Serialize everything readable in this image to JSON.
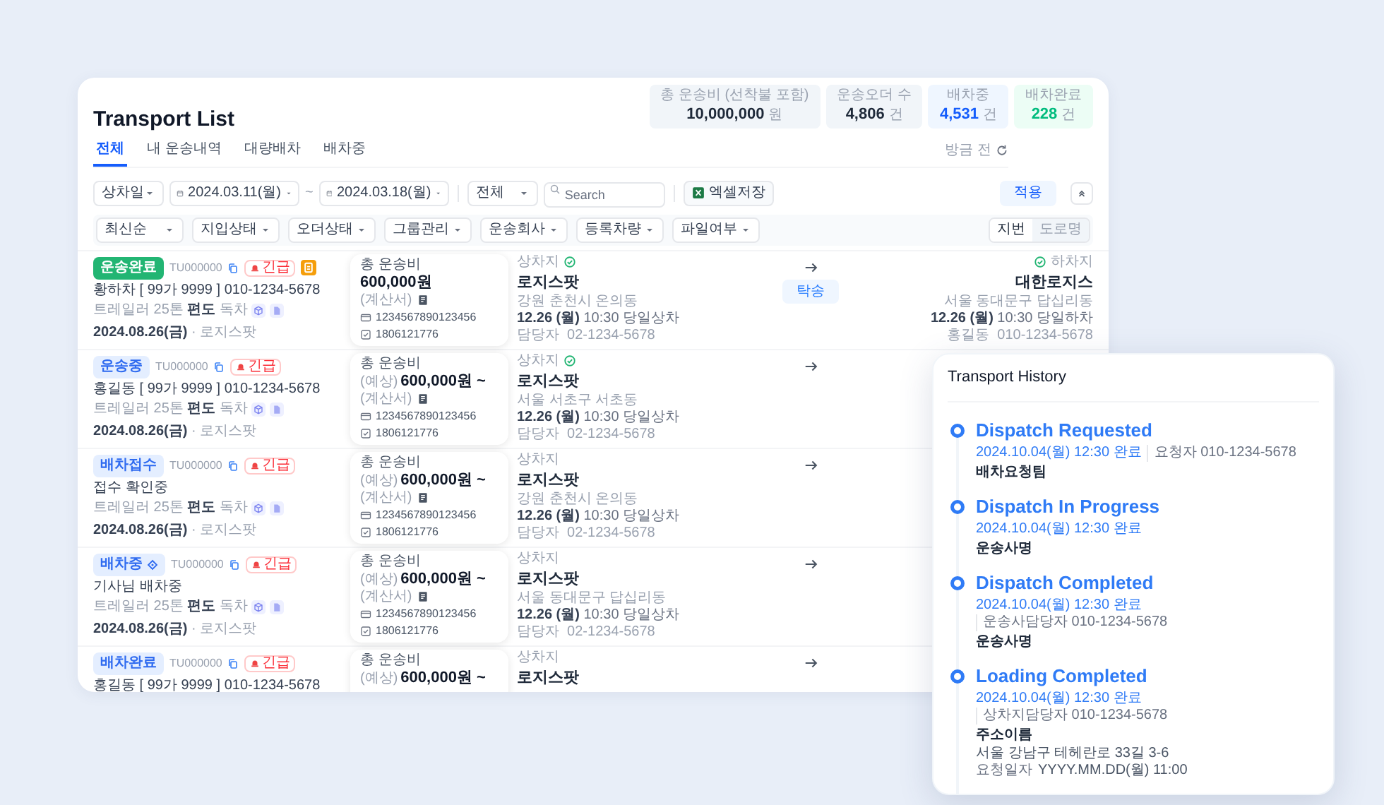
{
  "header": {
    "title": "Transport List",
    "refresh": "방금 전",
    "tabs": [
      {
        "label": "전체",
        "selected": true
      },
      {
        "label": "내 운송내역",
        "selected": false
      },
      {
        "label": "대량배차",
        "selected": false
      },
      {
        "label": "배차중",
        "selected": false
      }
    ]
  },
  "stats": [
    {
      "label": "총 운송비 (선착불 포함)",
      "value": "10,000,000",
      "unit": "원",
      "kind": "total"
    },
    {
      "label": "운송오더 수",
      "value": "4,806",
      "unit": "건",
      "kind": "count"
    },
    {
      "label": "배차중",
      "value": "4,531",
      "unit": "건",
      "kind": "dispatching"
    },
    {
      "label": "배차완료",
      "value": "228",
      "unit": "건",
      "kind": "done"
    }
  ],
  "filters": {
    "date_type": "상차일",
    "start_date": "2024.03.11(월)",
    "separator": "~",
    "end_date": "2024.03.18(월)",
    "scope": "전체",
    "search_placeholder": "Search",
    "excel": "엑셀저장",
    "apply": "적용",
    "dropdowns": [
      "최신순",
      "지입상태",
      "오더상태",
      "그룹관리",
      "운송회사",
      "등록차량",
      "파일여부"
    ],
    "address_modes": [
      {
        "label": "지번",
        "selected": true
      },
      {
        "label": "도로명",
        "selected": false
      }
    ]
  },
  "orders": [
    {
      "status": "운송완료",
      "color": "#22b573",
      "status_icon": false,
      "code": "TU000000",
      "urgent": "긴급",
      "document": true,
      "name": "황하차 [ 99가 9999 ] 010-1234-5678",
      "vehicle": "트레일러 25톤 **편도** 독차",
      "date": "**2024.08.26(금)** · 로지스팟",
      "fee": {
        "label": "총 운송비",
        "amount": "600,000원",
        "invoice": "(계산서)",
        "card": "1234567890123456",
        "phone": "1806121776"
      },
      "pickup": {
        "label": "상차지",
        "confirmed": true,
        "place": "로지스팟",
        "address": "강원 춘천시 온의동",
        "time": "**12.26 (월)** 10:30 당일상차",
        "contact": "담당자  02-1234-5678"
      },
      "transport_type": "탁송",
      "dropoff": {
        "label": "하차지",
        "confirmed": true,
        "place": "대한로지스",
        "address": "서울 동대문구 답십리동",
        "time": "**12.26 (월)** 10:30 당일하차",
        "contact": "홍길동  010-1234-5678"
      }
    },
    {
      "status": "운송중",
      "color": "#e4eeff",
      "status_icon": false,
      "code": "TU000000",
      "urgent": "긴급",
      "document": false,
      "name": "홍길동 [ 99가 9999 ] 010-1234-5678",
      "vehicle": "트레일러 25톤 **편도** 독차",
      "date": "**2024.08.26(금)** · 로지스팟",
      "fee": {
        "label": "총 운송비",
        "prefix": "(예상)",
        "amount": "600,000원 ~",
        "invoice": "(계산서)",
        "card": "1234567890123456",
        "phone": "1806121776"
      },
      "pickup": {
        "label": "상차지",
        "confirmed": true,
        "place": "로지스팟",
        "address": "서울 서초구 서초동",
        "time": "**12.26 (월)** 10:30 당일상차",
        "contact": "담당자  02-1234-5678"
      }
    },
    {
      "status": "배차접수",
      "color": "#e4eeff",
      "status_icon": false,
      "code": "TU000000",
      "urgent": "긴급",
      "document": false,
      "name": "접수 확인중",
      "vehicle": "트레일러 25톤 **편도** 독차",
      "date": "**2024.08.26(금)** · 로지스팟",
      "fee": {
        "label": "총 운송비",
        "prefix": "(예상)",
        "amount": "600,000원 ~",
        "invoice": "(계산서)",
        "card": "1234567890123456",
        "phone": "1806121776"
      },
      "pickup": {
        "label": "상차지",
        "confirmed": false,
        "place": "로지스팟",
        "address": "강원 춘천시 온의동",
        "time": "**12.26 (월)** 10:30 당일상차",
        "contact": "담당자  02-1234-5678"
      }
    },
    {
      "status": "배차중",
      "color": "#e4eeff",
      "status_icon": true,
      "code": "TU000000",
      "urgent": "긴급",
      "document": false,
      "name": "기사님 배차중",
      "vehicle": "트레일러 25톤 **편도** 독차",
      "date": "**2024.08.26(금)** · 로지스팟",
      "fee": {
        "label": "총 운송비",
        "prefix": "(예상)",
        "amount": "600,000원 ~",
        "invoice": "(계산서)",
        "card": "1234567890123456",
        "phone": "1806121776"
      },
      "pickup": {
        "label": "상차지",
        "confirmed": false,
        "place": "로지스팟",
        "address": "서울 동대문구 답십리동",
        "time": "**12.26 (월)** 10:30 당일상차",
        "contact": "담당자  02-1234-5678"
      }
    },
    {
      "status": "배차완료",
      "color": "#e4eeff",
      "status_icon": false,
      "code": "TU000000",
      "urgent": "긴급",
      "document": false,
      "name": "홍길동 [ 99가 9999 ] 010-1234-5678",
      "fee": {
        "label": "총 운송비",
        "prefix": "(예상)",
        "amount": "600,000원 ~"
      },
      "pickup": {
        "label": "상차지",
        "confirmed": false,
        "place": "로지스팟"
      }
    }
  ],
  "history": {
    "title": "Transport History",
    "steps": [
      {
        "title": "Dispatch Requested",
        "time": "2024.10.04(월) 12:30 완료",
        "actor": "요청자 010-1234-5678",
        "team": "배차요청팀"
      },
      {
        "title": "Dispatch In Progress",
        "time": "2024.10.04(월) 12:30 완료",
        "team": "운송사명"
      },
      {
        "title": "Dispatch Completed",
        "time": "2024.10.04(월) 12:30 완료",
        "actor": "운송사담당자 010-1234-5678",
        "team": "운송사명"
      },
      {
        "title": "Loading Completed",
        "time": "2024.10.04(월) 12:30 완료",
        "actor": "상차지담당자 010-1234-5678",
        "team": "주소이름",
        "address": "서울 강남구 테헤란로 33길 3-6",
        "request_label": "요청일자",
        "request_time": "YYYY.MM.DD(월) 11:00"
      }
    ]
  }
}
